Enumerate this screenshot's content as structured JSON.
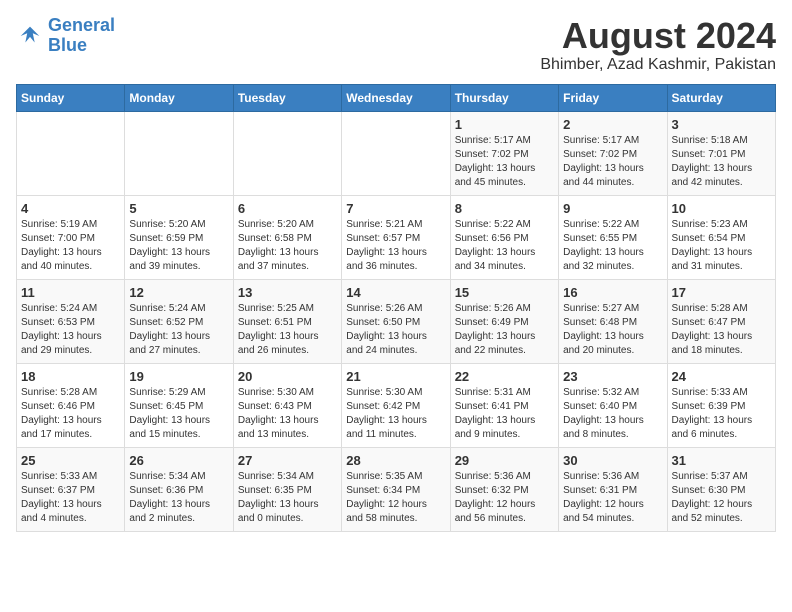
{
  "header": {
    "logo_line1": "General",
    "logo_line2": "Blue",
    "title": "August 2024",
    "subtitle": "Bhimber, Azad Kashmir, Pakistan"
  },
  "days_of_week": [
    "Sunday",
    "Monday",
    "Tuesday",
    "Wednesday",
    "Thursday",
    "Friday",
    "Saturday"
  ],
  "weeks": [
    [
      {
        "day": "",
        "info": ""
      },
      {
        "day": "",
        "info": ""
      },
      {
        "day": "",
        "info": ""
      },
      {
        "day": "",
        "info": ""
      },
      {
        "day": "1",
        "info": "Sunrise: 5:17 AM\nSunset: 7:02 PM\nDaylight: 13 hours\nand 45 minutes."
      },
      {
        "day": "2",
        "info": "Sunrise: 5:17 AM\nSunset: 7:02 PM\nDaylight: 13 hours\nand 44 minutes."
      },
      {
        "day": "3",
        "info": "Sunrise: 5:18 AM\nSunset: 7:01 PM\nDaylight: 13 hours\nand 42 minutes."
      }
    ],
    [
      {
        "day": "4",
        "info": "Sunrise: 5:19 AM\nSunset: 7:00 PM\nDaylight: 13 hours\nand 40 minutes."
      },
      {
        "day": "5",
        "info": "Sunrise: 5:20 AM\nSunset: 6:59 PM\nDaylight: 13 hours\nand 39 minutes."
      },
      {
        "day": "6",
        "info": "Sunrise: 5:20 AM\nSunset: 6:58 PM\nDaylight: 13 hours\nand 37 minutes."
      },
      {
        "day": "7",
        "info": "Sunrise: 5:21 AM\nSunset: 6:57 PM\nDaylight: 13 hours\nand 36 minutes."
      },
      {
        "day": "8",
        "info": "Sunrise: 5:22 AM\nSunset: 6:56 PM\nDaylight: 13 hours\nand 34 minutes."
      },
      {
        "day": "9",
        "info": "Sunrise: 5:22 AM\nSunset: 6:55 PM\nDaylight: 13 hours\nand 32 minutes."
      },
      {
        "day": "10",
        "info": "Sunrise: 5:23 AM\nSunset: 6:54 PM\nDaylight: 13 hours\nand 31 minutes."
      }
    ],
    [
      {
        "day": "11",
        "info": "Sunrise: 5:24 AM\nSunset: 6:53 PM\nDaylight: 13 hours\nand 29 minutes."
      },
      {
        "day": "12",
        "info": "Sunrise: 5:24 AM\nSunset: 6:52 PM\nDaylight: 13 hours\nand 27 minutes."
      },
      {
        "day": "13",
        "info": "Sunrise: 5:25 AM\nSunset: 6:51 PM\nDaylight: 13 hours\nand 26 minutes."
      },
      {
        "day": "14",
        "info": "Sunrise: 5:26 AM\nSunset: 6:50 PM\nDaylight: 13 hours\nand 24 minutes."
      },
      {
        "day": "15",
        "info": "Sunrise: 5:26 AM\nSunset: 6:49 PM\nDaylight: 13 hours\nand 22 minutes."
      },
      {
        "day": "16",
        "info": "Sunrise: 5:27 AM\nSunset: 6:48 PM\nDaylight: 13 hours\nand 20 minutes."
      },
      {
        "day": "17",
        "info": "Sunrise: 5:28 AM\nSunset: 6:47 PM\nDaylight: 13 hours\nand 18 minutes."
      }
    ],
    [
      {
        "day": "18",
        "info": "Sunrise: 5:28 AM\nSunset: 6:46 PM\nDaylight: 13 hours\nand 17 minutes."
      },
      {
        "day": "19",
        "info": "Sunrise: 5:29 AM\nSunset: 6:45 PM\nDaylight: 13 hours\nand 15 minutes."
      },
      {
        "day": "20",
        "info": "Sunrise: 5:30 AM\nSunset: 6:43 PM\nDaylight: 13 hours\nand 13 minutes."
      },
      {
        "day": "21",
        "info": "Sunrise: 5:30 AM\nSunset: 6:42 PM\nDaylight: 13 hours\nand 11 minutes."
      },
      {
        "day": "22",
        "info": "Sunrise: 5:31 AM\nSunset: 6:41 PM\nDaylight: 13 hours\nand 9 minutes."
      },
      {
        "day": "23",
        "info": "Sunrise: 5:32 AM\nSunset: 6:40 PM\nDaylight: 13 hours\nand 8 minutes."
      },
      {
        "day": "24",
        "info": "Sunrise: 5:33 AM\nSunset: 6:39 PM\nDaylight: 13 hours\nand 6 minutes."
      }
    ],
    [
      {
        "day": "25",
        "info": "Sunrise: 5:33 AM\nSunset: 6:37 PM\nDaylight: 13 hours\nand 4 minutes."
      },
      {
        "day": "26",
        "info": "Sunrise: 5:34 AM\nSunset: 6:36 PM\nDaylight: 13 hours\nand 2 minutes."
      },
      {
        "day": "27",
        "info": "Sunrise: 5:34 AM\nSunset: 6:35 PM\nDaylight: 13 hours\nand 0 minutes."
      },
      {
        "day": "28",
        "info": "Sunrise: 5:35 AM\nSunset: 6:34 PM\nDaylight: 12 hours\nand 58 minutes."
      },
      {
        "day": "29",
        "info": "Sunrise: 5:36 AM\nSunset: 6:32 PM\nDaylight: 12 hours\nand 56 minutes."
      },
      {
        "day": "30",
        "info": "Sunrise: 5:36 AM\nSunset: 6:31 PM\nDaylight: 12 hours\nand 54 minutes."
      },
      {
        "day": "31",
        "info": "Sunrise: 5:37 AM\nSunset: 6:30 PM\nDaylight: 12 hours\nand 52 minutes."
      }
    ]
  ]
}
